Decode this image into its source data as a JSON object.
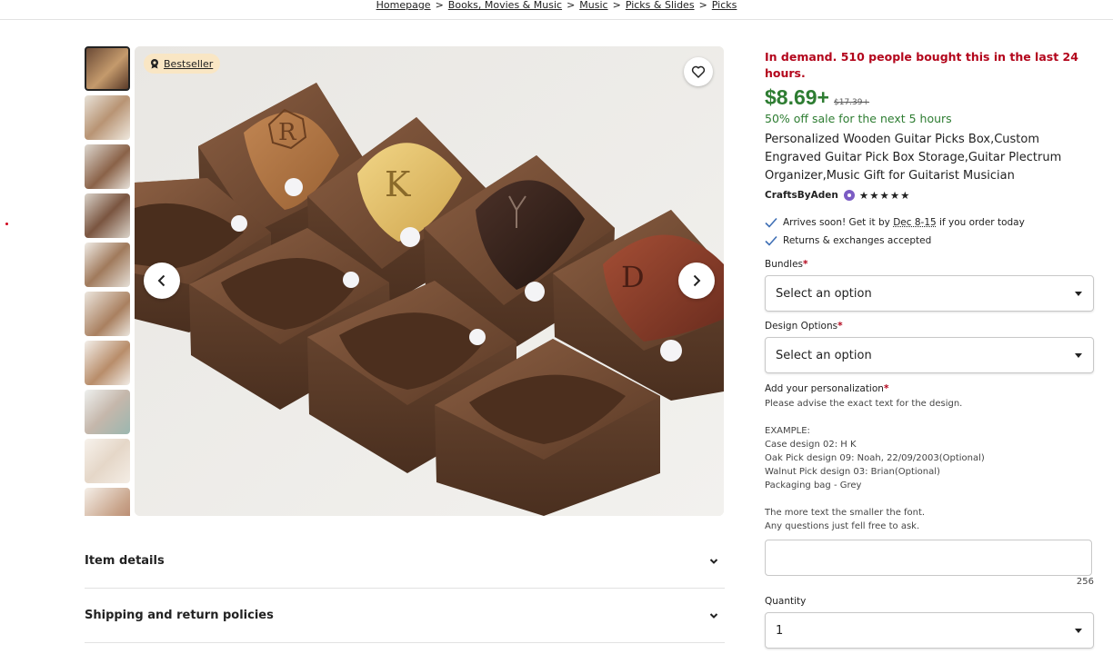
{
  "breadcrumb": [
    "Homepage",
    "Books, Movies & Music",
    "Music",
    "Picks & Slides",
    "Picks"
  ],
  "breadcrumb_separator": ">",
  "gallery": {
    "bestseller_label": "Bestseller",
    "thumbnail_count": 10,
    "pick_letters": [
      "R",
      "K",
      "D"
    ]
  },
  "accordion": {
    "item_details": "Item details",
    "shipping": "Shipping and return policies"
  },
  "listing": {
    "demand": "In demand. 510 people bought this in the last 24 hours.",
    "price": "$8.69+",
    "original_price": "$17.39+",
    "sale": "50% off sale for the next 5 hours",
    "title": "Personalized Wooden Guitar Picks Box,Custom Engraved Guitar Pick Box Storage,Guitar Plectrum Organizer,Music Gift for Guitarist Musician",
    "shop": "CraftsByAden",
    "rating_stars": "★★★★★",
    "arrival_prefix": "Arrives soon! Get it by ",
    "arrival_dates": "Dec 8-15",
    "arrival_suffix": " if you order today",
    "returns": "Returns & exchanges accepted"
  },
  "form": {
    "bundles_label": "Bundles",
    "bundles_value": "Select an option",
    "design_label": "Design Options",
    "design_value": "Select an option",
    "personalization_label": "Add your personalization",
    "instructions": "Please advise the exact text for the design.",
    "example_lines": [
      "EXAMPLE:",
      "Case design 02: H K",
      "Oak Pick design 09: Noah, 22/09/2003(Optional)",
      "Walnut Pick design 03: Brian(Optional)",
      "Packaging bag - Grey"
    ],
    "font_note": "The more text the smaller the font.",
    "questions_note": "Any questions just fell free to ask.",
    "char_limit": "256",
    "quantity_label": "Quantity",
    "quantity_value": "1"
  },
  "colors": {
    "price_green": "#2e7d32",
    "demand_red": "#b3061c",
    "bestseller_bg": "#f9e6c4",
    "star_seller_purple": "#7b5cc4",
    "walnut": "#6b4630"
  }
}
